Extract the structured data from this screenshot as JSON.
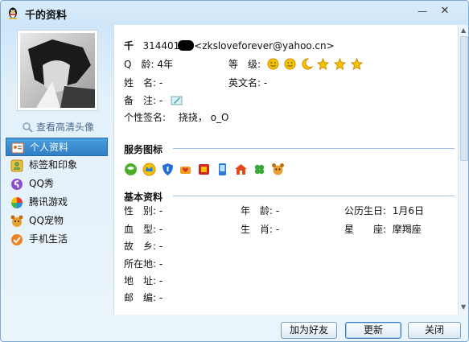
{
  "window": {
    "title": "千的资料"
  },
  "titlebar": {
    "minimize": "—",
    "close": "✕"
  },
  "left": {
    "hd_link": "查看高清头像",
    "nav": [
      {
        "label": "个人资料",
        "icon": "profile-card-icon",
        "active": true
      },
      {
        "label": "标签和印象",
        "icon": "tag-icon"
      },
      {
        "label": "QQ秀",
        "icon": "qqshow-icon"
      },
      {
        "label": "腾讯游戏",
        "icon": "game-icon"
      },
      {
        "label": "QQ宠物",
        "icon": "pet-icon"
      },
      {
        "label": "手机生活",
        "icon": "mobile-life-icon"
      }
    ]
  },
  "profile": {
    "nickname": "千",
    "qq_prefix": "314401",
    "email": "<zksloveforever@yahoo.cn>",
    "age_label": "Q　龄:",
    "age_value": "4年",
    "level_label": "等　级:",
    "name_label": "姓　名:",
    "name_value": "-",
    "eng_label": "英文名:",
    "eng_value": "-",
    "remark_label": "备　注:",
    "remark_value": "-",
    "sig_label": "个性签名:",
    "sig_value": "挠挠，  o_O"
  },
  "services": {
    "title": "服务图标"
  },
  "basic": {
    "title": "基本资料",
    "rows": [
      {
        "l1": "性　别:",
        "v1": "-",
        "l2": "年　龄:",
        "v2": "-",
        "l3": "公历生日:",
        "v3": "1月6日"
      },
      {
        "l1": "血　型:",
        "v1": "-",
        "l2": "生　肖:",
        "v2": "-",
        "l3": "星　　座:",
        "v3": "摩羯座"
      },
      {
        "l1": "故　乡:",
        "v1": "-"
      },
      {
        "l1": "所在地:",
        "v1": "-"
      },
      {
        "l1": "地　址:",
        "v1": "-"
      },
      {
        "l1": "邮　编:",
        "v1": "-"
      }
    ]
  },
  "buttons": {
    "add_friend": "加为好友",
    "refresh": "更新",
    "close": "关闭"
  },
  "colors": {
    "accent": "#2f7fc4",
    "section_line": "#9ec3e2"
  }
}
